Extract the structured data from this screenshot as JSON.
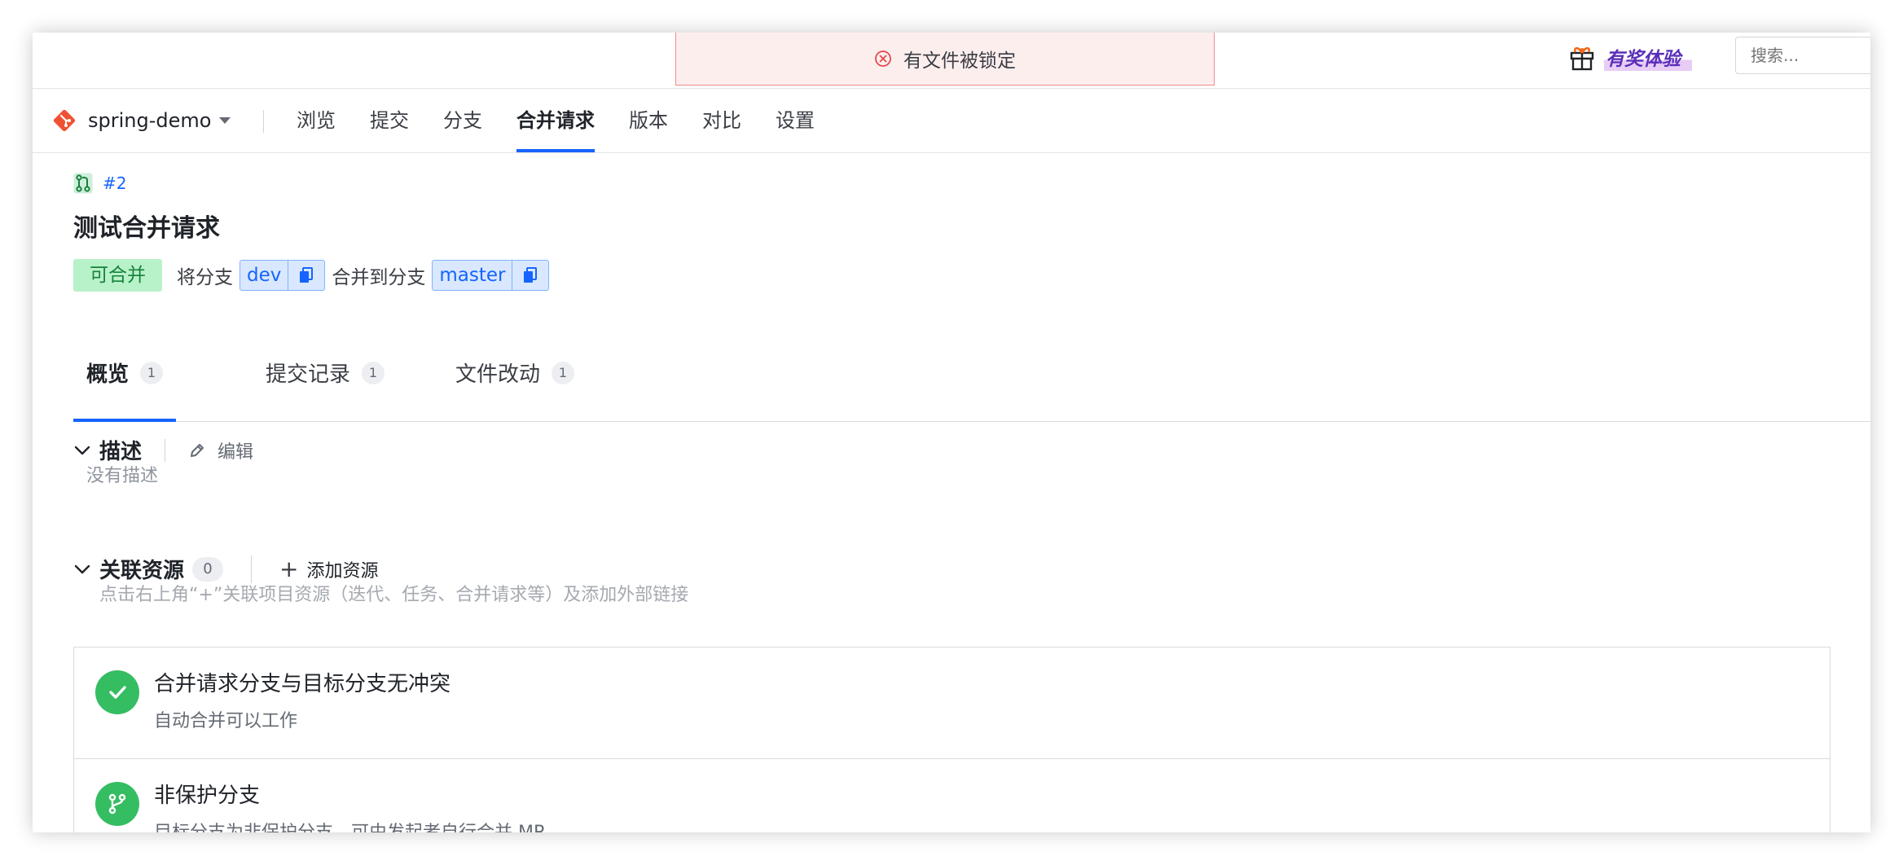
{
  "toast": {
    "message": "有文件被锁定"
  },
  "header": {
    "promo_label": "有奖体验",
    "search_placeholder": "搜索..."
  },
  "repo": {
    "name": "spring-demo"
  },
  "nav": {
    "items": [
      {
        "label": "浏览"
      },
      {
        "label": "提交"
      },
      {
        "label": "分支"
      },
      {
        "label": "合并请求",
        "active": true
      },
      {
        "label": "版本"
      },
      {
        "label": "对比"
      },
      {
        "label": "设置"
      }
    ]
  },
  "mr": {
    "id": "#2",
    "title": "测试合并请求",
    "status": "可合并",
    "from_prefix": "将分支",
    "source_branch": "dev",
    "to_prefix": "合并到分支",
    "target_branch": "master"
  },
  "tabs": [
    {
      "label": "概览",
      "count": "1",
      "active": true
    },
    {
      "label": "提交记录",
      "count": "1"
    },
    {
      "label": "文件改动",
      "count": "1"
    }
  ],
  "description": {
    "title": "描述",
    "edit_label": "编辑",
    "empty_text": "没有描述"
  },
  "resources": {
    "title": "关联资源",
    "count": "0",
    "add_label": "添加资源",
    "hint": "点击右上角“+”关联项目资源（迭代、任务、合并请求等）及添加外部链接"
  },
  "checks": [
    {
      "title": "合并请求分支与目标分支无冲突",
      "subtitle": "自动合并可以工作",
      "icon": "check-icon"
    },
    {
      "title": "非保护分支",
      "subtitle": "目标分支为非保护分支，可由发起者自行合并 MR",
      "icon": "branch-icon"
    }
  ],
  "colors": {
    "accent": "#1664ff",
    "success": "#35bd62",
    "error": "#e5484d"
  }
}
